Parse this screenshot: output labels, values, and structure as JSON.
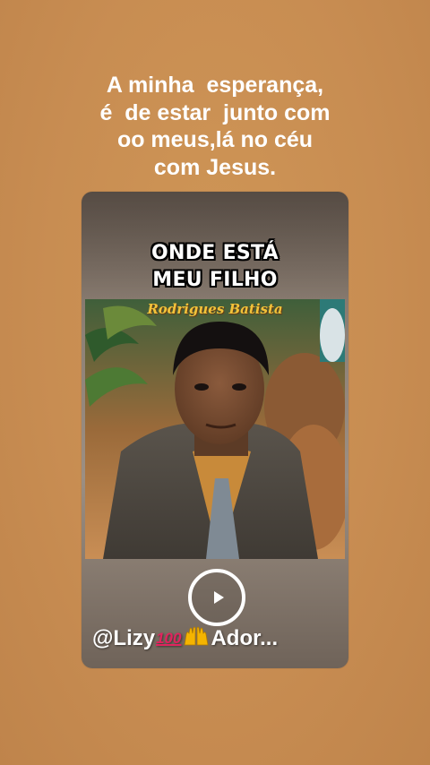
{
  "caption": {
    "lines": [
      "A minha  esperança,",
      "é  de estar  junto com",
      "oo meus,lá no céu",
      "com Jesus."
    ]
  },
  "card": {
    "cover_title_lines": [
      "ONDE ESTÁ",
      "MEU FILHO"
    ],
    "artist": "Rodrigues Batista",
    "watermark": {
      "handle": "@Lizy",
      "hundred": "100",
      "suffix": "Ador..."
    },
    "play_icon": "play-icon"
  },
  "colors": {
    "background": "#c88d52",
    "caption_text": "#ffffff",
    "artist_text": "#f2c23a",
    "hundred_emoji": "#e0245e"
  }
}
